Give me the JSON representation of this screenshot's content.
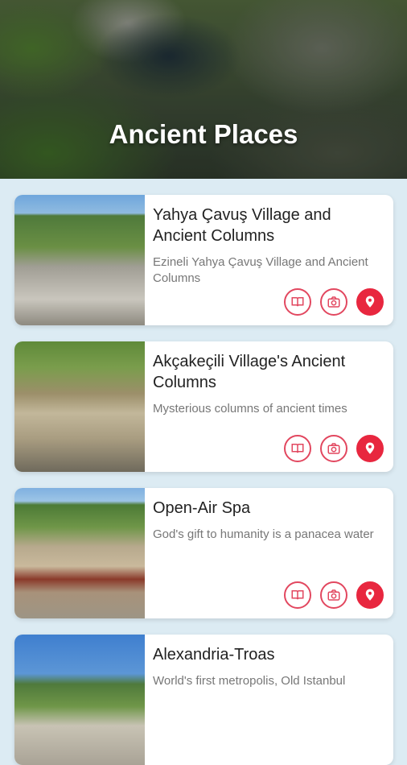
{
  "header": {
    "title": "Ancient Places"
  },
  "places": [
    {
      "title": "Yahya Çavuş Village and Ancient Columns",
      "subtitle": "Ezineli Yahya Çavuş Village and Ancient Columns"
    },
    {
      "title": "Akçakeçili Village's Ancient Columns",
      "subtitle": "Mysterious columns of ancient times"
    },
    {
      "title": "Open-Air Spa",
      "subtitle": "God's gift to humanity is a panacea water"
    },
    {
      "title": "Alexandria-Troas",
      "subtitle": "World's first metropolis, Old Istanbul"
    }
  ],
  "icons": {
    "read": "book-icon",
    "gallery": "camera-icon",
    "map": "location-pin-icon"
  },
  "colors": {
    "accent": "#e8273f",
    "background": "#dcebf3"
  }
}
